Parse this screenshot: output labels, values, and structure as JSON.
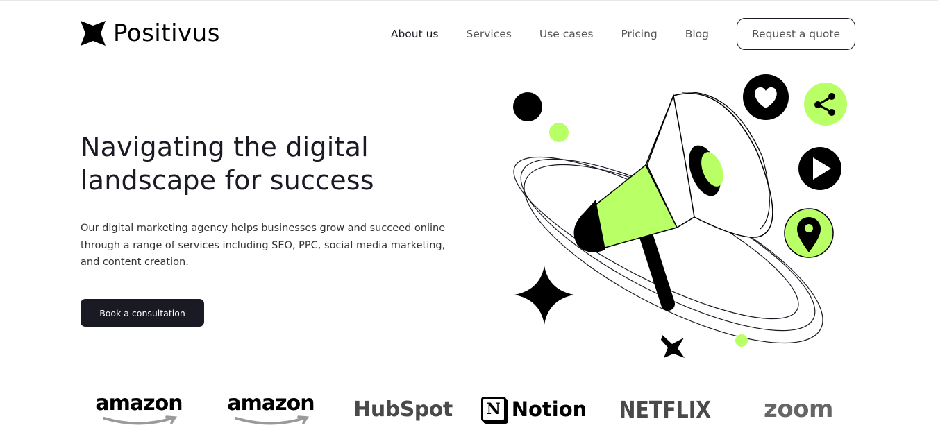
{
  "brand": {
    "name": "Positivus",
    "accent_color": "#B9FF66",
    "dark_color": "#191A23"
  },
  "nav": {
    "items": [
      {
        "label": "About us"
      },
      {
        "label": "Services"
      },
      {
        "label": "Use cases"
      },
      {
        "label": "Pricing"
      },
      {
        "label": "Blog"
      }
    ],
    "cta_label": "Request a quote"
  },
  "hero": {
    "title": "Navigating the digital landscape for success",
    "description": "Our digital marketing agency helps businesses grow and succeed online through a range of services including SEO, PPC, social media marketing, and content creation.",
    "cta_label": "Book a consultation",
    "illustration_icons": [
      "megaphone-icon",
      "heart-icon",
      "share-icon",
      "play-icon",
      "location-pin-icon",
      "star-icon"
    ]
  },
  "client_logos": [
    {
      "name": "amazon"
    },
    {
      "name": "amazon"
    },
    {
      "name": "HubSpot"
    },
    {
      "name": "Notion"
    },
    {
      "name": "NETFLIX"
    },
    {
      "name": "zoom"
    }
  ]
}
